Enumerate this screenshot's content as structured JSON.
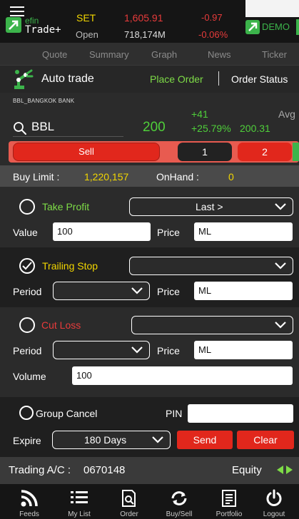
{
  "brand": {
    "logo_small": "efin",
    "logo_large": "Trade+"
  },
  "index": {
    "name": "SET",
    "session": "Open",
    "value": "1,605.91",
    "volume": "718,174M",
    "change": "-0.97",
    "change_pct": "-0.06%"
  },
  "mode": {
    "label": "DEMO"
  },
  "nav": {
    "tabs": [
      "Quote",
      "Summary",
      "Graph",
      "News",
      "Ticker"
    ]
  },
  "auto_trade": {
    "title": "Auto trade",
    "place_order": "Place Order",
    "order_status": "Order Status"
  },
  "symbol": {
    "full_name": "BBL_BANGKOK BANK",
    "code": "BBL",
    "last": "200",
    "change": "+41",
    "change_pct": "+25.79%",
    "avg_label": "Avg",
    "avg_value": "200.31"
  },
  "side": {
    "sell_label": "Sell",
    "page_1": "1",
    "page_2": "2"
  },
  "limits": {
    "buy_limit_label": "Buy Limit :",
    "buy_limit_value": "1,220,157",
    "onhand_label": "OnHand :",
    "onhand_value": "0"
  },
  "take_profit": {
    "label": "Take Profit",
    "checked": false,
    "select_value": "Last >",
    "value_label": "Value",
    "value": "100",
    "price_label": "Price",
    "price": "ML"
  },
  "trailing_stop": {
    "label": "Trailing Stop",
    "checked": true,
    "select_value": "",
    "period_label": "Period",
    "period_value": "",
    "price_label": "Price",
    "price": "ML"
  },
  "cut_loss": {
    "label": "Cut Loss",
    "checked": false,
    "select_value": "",
    "period_label": "Period",
    "period_value": "",
    "price_label": "Price",
    "price": "ML"
  },
  "volume": {
    "label": "Volume",
    "value": "100"
  },
  "group_cancel": {
    "label": "Group Cancel",
    "checked": false,
    "pin_label": "PIN",
    "pin_value": ""
  },
  "expire": {
    "label": "Expire",
    "value": "180 Days",
    "send_label": "Send",
    "clear_label": "Clear"
  },
  "account": {
    "label": "Trading A/C :",
    "number": "0670148",
    "type": "Equity"
  },
  "tabbar": {
    "items": [
      "Feeds",
      "My List",
      "Order",
      "Buy/Sell",
      "Portfolio",
      "Logout"
    ]
  },
  "colors": {
    "green": "#7edc47",
    "red": "#e1271c",
    "yellow": "#f2d600",
    "bg": "#2b2b2b"
  }
}
